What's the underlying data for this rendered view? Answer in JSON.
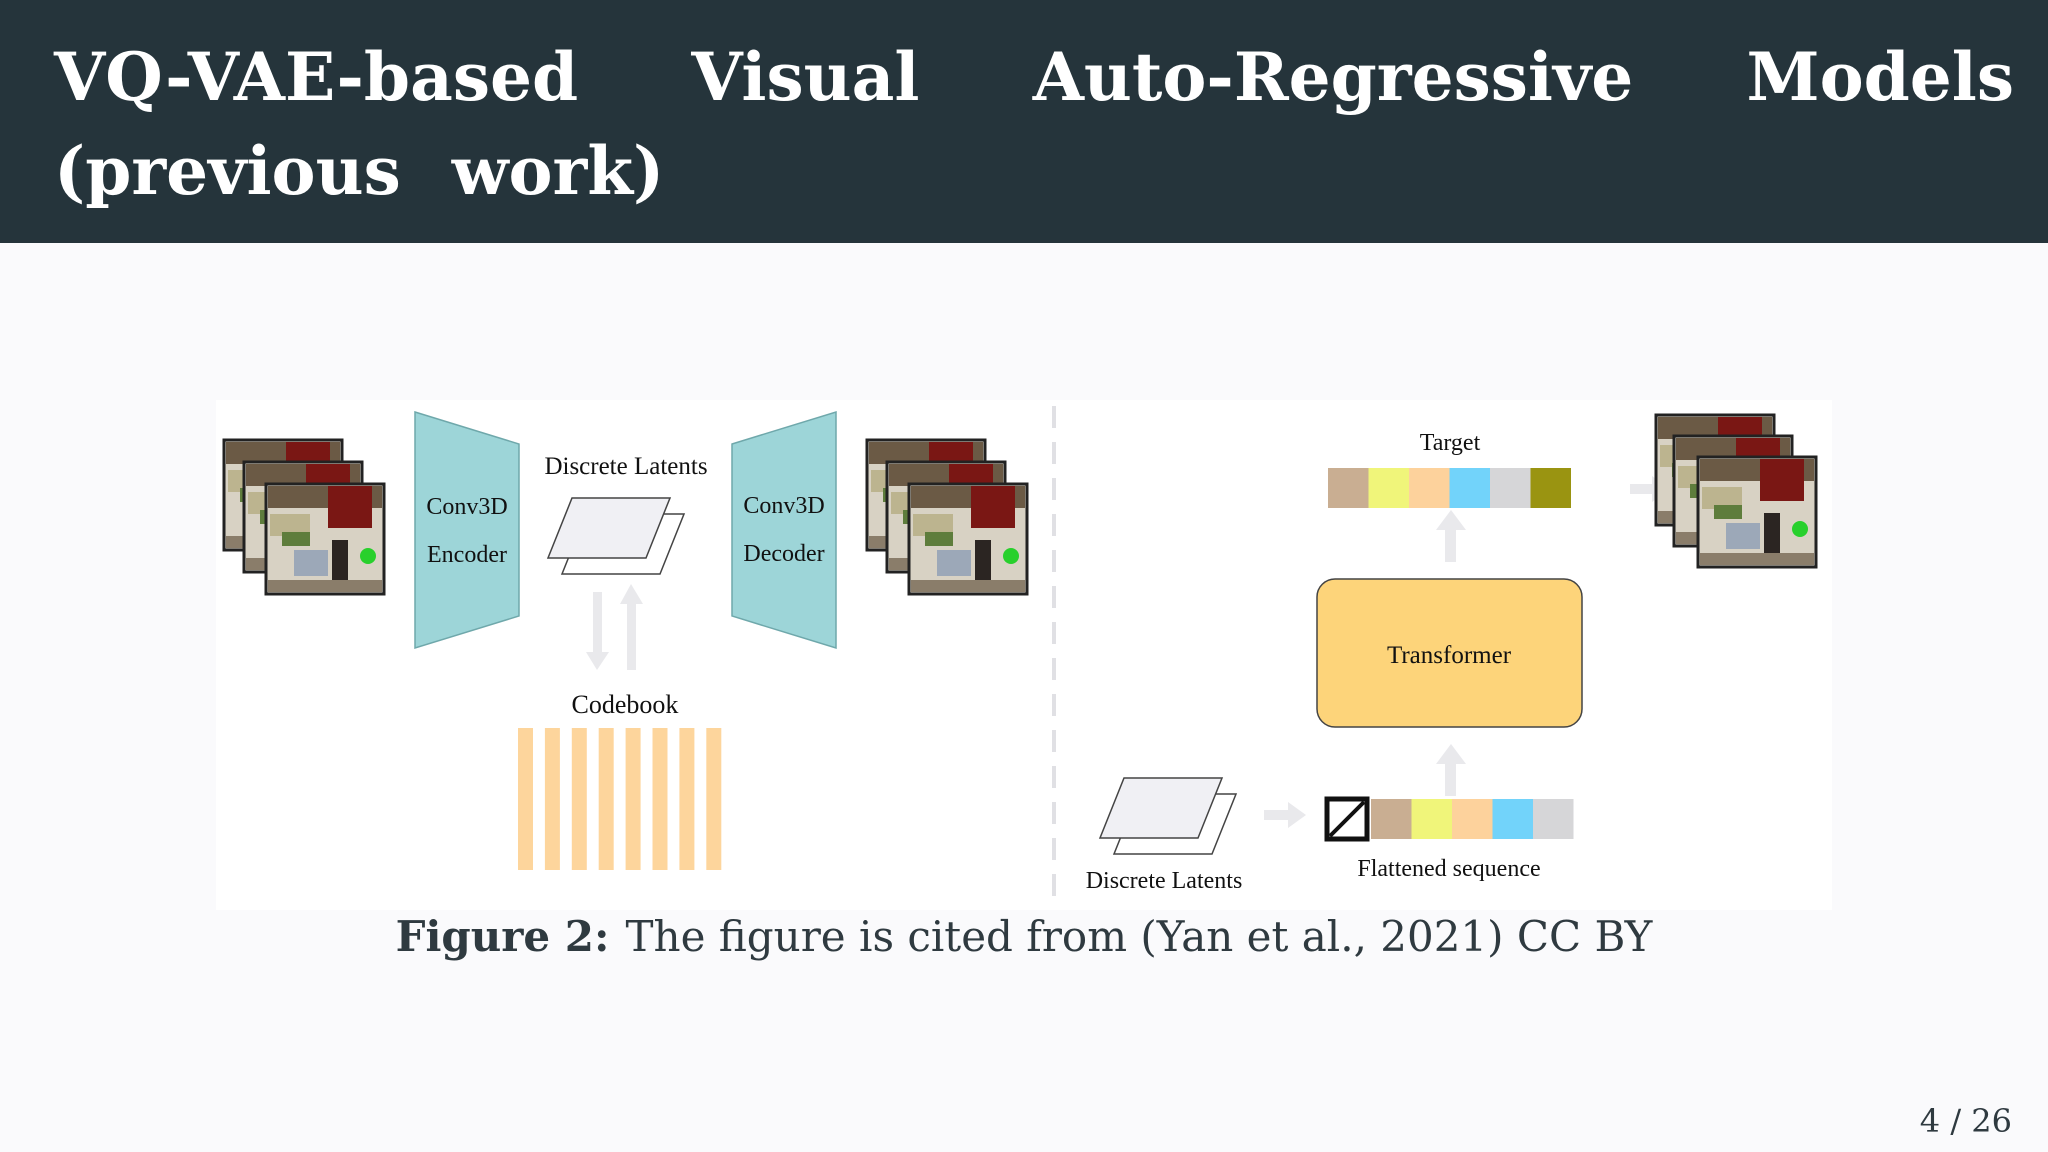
{
  "slide": {
    "title": "VQ-VAE-based Visual Auto-Regressive Models (previous work)",
    "page_number": "4 / 26"
  },
  "figure": {
    "caption_label": "Figure 2:",
    "caption_text": "The figure is cited from (Yan et al., 2021) CC BY",
    "left": {
      "encoder_line1": "Conv3D",
      "encoder_line2": "Encoder",
      "decoder_line1": "Conv3D",
      "decoder_line2": "Decoder",
      "latents_label": "Discrete Latents",
      "codebook_label": "Codebook",
      "codebook_bar_count": 8
    },
    "right": {
      "target_label": "Target",
      "transformer_label": "Transformer",
      "latents_label": "Discrete Latents",
      "sequence_label": "Flattened sequence",
      "target_colors": [
        "#c9ae92",
        "#f0f57a",
        "#fdd29c",
        "#72d3fa",
        "#d6d6d8",
        "#9a9411"
      ],
      "sequence_colors": [
        "#c9ae92",
        "#f0f57a",
        "#fdd29c",
        "#72d3fa",
        "#d6d6d8"
      ]
    },
    "colors": {
      "conv_block": "#9dd5d8",
      "codebook": "#fdd59c",
      "transformer": "#fdd47a",
      "arrow": "#e9e9ec",
      "latent_sheet": "#f0f0f4"
    }
  }
}
